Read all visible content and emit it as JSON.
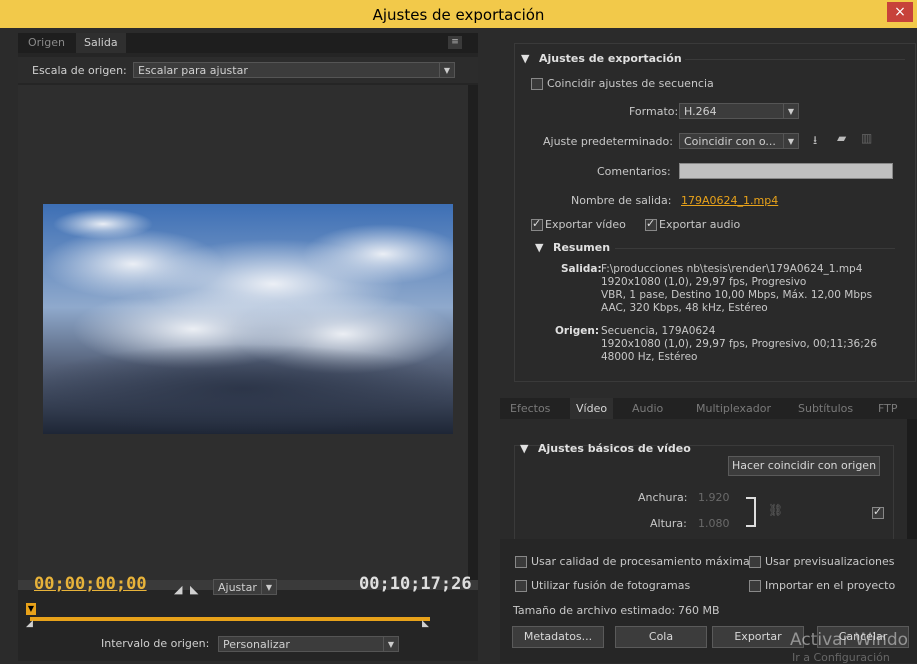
{
  "window": {
    "title": "Ajustes de exportación",
    "close": "×"
  },
  "left": {
    "tabs": [
      "Origen",
      "Salida"
    ],
    "scale_label": "Escala de origen:",
    "scale_value": "Escalar para ajustar",
    "timecode_start": "00;00;00;00",
    "timecode_end": "00;10;17;26",
    "fit_value": "Ajustar",
    "interval_label": "Intervalo de origen:",
    "interval_value": "Personalizar"
  },
  "export": {
    "section_title": "Ajustes de exportación",
    "match_sequence": "Coincidir ajustes de secuencia",
    "format_label": "Formato:",
    "format_value": "H.264",
    "preset_label": "Ajuste predeterminado:",
    "preset_value": "Coincidir con o...",
    "comments_label": "Comentarios:",
    "output_name_label": "Nombre de salida:",
    "output_name_value": "179A0624_1.mp4",
    "export_video": "Exportar vídeo",
    "export_audio": "Exportar audio",
    "summary_title": "Resumen",
    "output_label": "Salida:",
    "output_lines": [
      "F:\\producciones nb\\tesis\\render\\179A0624_1.mp4",
      "1920x1080 (1,0), 29,97 fps, Progresivo",
      "VBR, 1 pase, Destino 10,00 Mbps, Máx. 12,00 Mbps",
      "AAC, 320 Kbps, 48 kHz, Estéreo"
    ],
    "source_label": "Origen:",
    "source_lines": [
      "Secuencia, 179A0624",
      "1920x1080 (1,0), 29,97 fps, Progresivo, 00;11;36;26",
      "48000 Hz, Estéreo"
    ]
  },
  "bottom_tabs": [
    "Efectos",
    "Vídeo",
    "Audio",
    "Multiplexador",
    "Subtítulos",
    "FTP"
  ],
  "video": {
    "section_title": "Ajustes básicos de vídeo",
    "match_source_button": "Hacer coincidir con origen",
    "width_label": "Anchura:",
    "width_value": "1.920",
    "height_label": "Altura:",
    "height_value": "1.080"
  },
  "options": {
    "max_quality": "Usar calidad de procesamiento máxima",
    "use_previews": "Usar previsualizaciones",
    "frame_blending": "Utilizar fusión de fotogramas",
    "import_project": "Importar en el proyecto",
    "file_size_label": "Tamaño de archivo estimado:",
    "file_size_value": "760 MB"
  },
  "buttons": {
    "metadata": "Metadatos...",
    "queue": "Cola",
    "export": "Exportar",
    "cancel": "Cancelar"
  },
  "watermark": {
    "line1": "Activar Windo",
    "line2": "Ir a Configuración"
  }
}
